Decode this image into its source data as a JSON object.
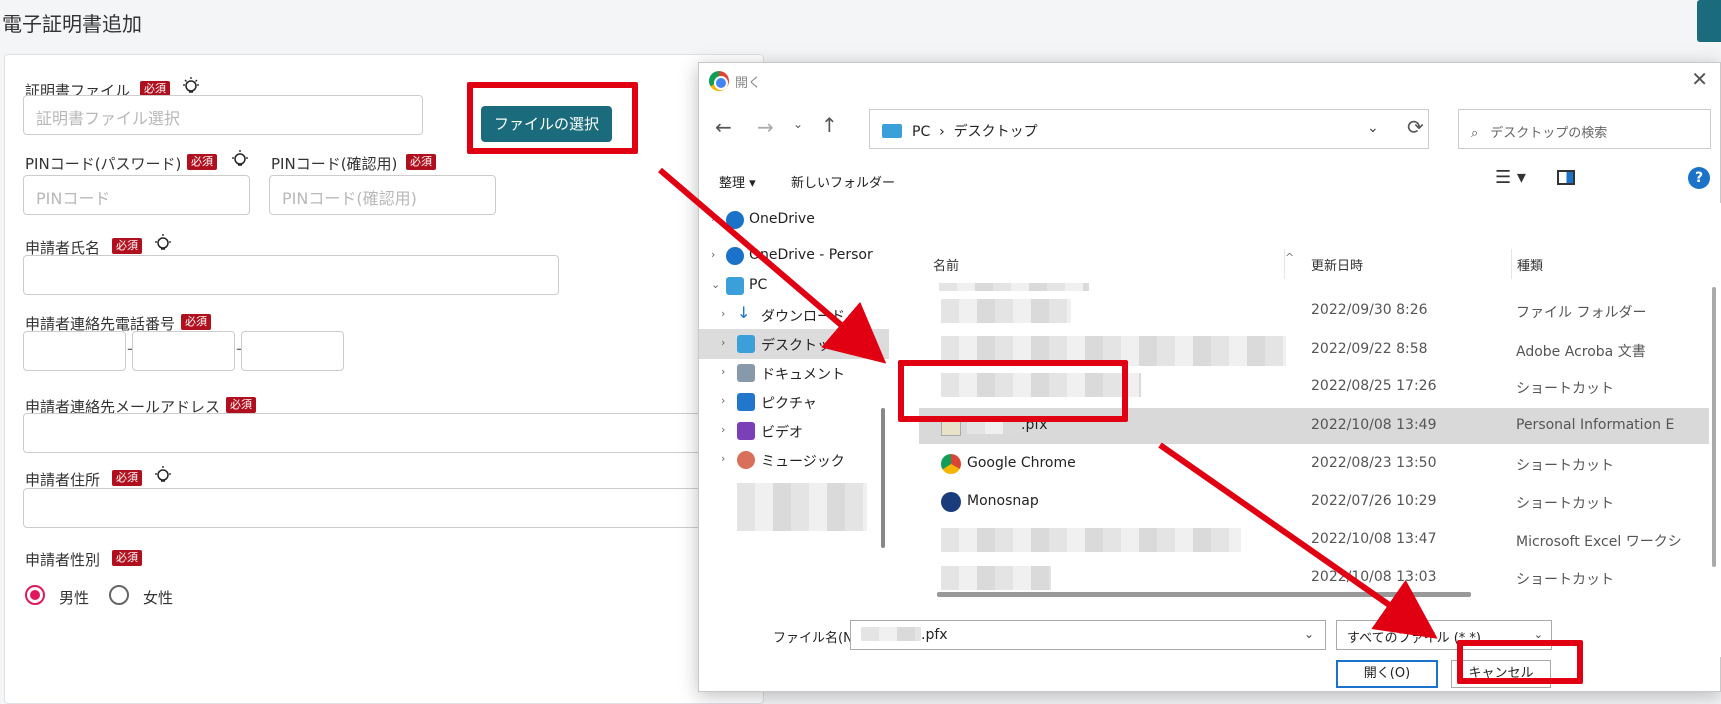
{
  "page": {
    "title": "電子証明書追加"
  },
  "form": {
    "cert_file_label": "証明書ファイル",
    "cert_file_placeholder": "証明書ファイル選択",
    "file_select_button": "ファイルの選択",
    "pin_label": "PINコード(パスワード)",
    "pin_placeholder": "PINコード",
    "pin_confirm_label": "PINコード(確認用)",
    "pin_confirm_placeholder": "PINコード(確認用)",
    "applicant_name_label": "申請者氏名",
    "phone_label": "申請者連絡先電話番号",
    "phone_separator": "-",
    "email_label": "申請者連絡先メールアドレス",
    "address_label": "申請者住所",
    "gender_label": "申請者性別",
    "gender_options": [
      "男性",
      "女性"
    ],
    "gender_selected": "男性",
    "required_badge": "必須"
  },
  "dialog": {
    "title": "開く",
    "breadcrumb": [
      "PC",
      "デスクトップ"
    ],
    "search_placeholder": "デスクトップの検索",
    "toolbar": {
      "organize": "整理 ▾",
      "new_folder": "新しいフォルダー"
    },
    "nav": [
      {
        "label": "OneDrive",
        "icon": "cloud-icon"
      },
      {
        "label": "OneDrive - Persor",
        "icon": "cloud-icon"
      },
      {
        "label": "PC",
        "icon": "computer-icon"
      },
      {
        "label": "ダウンロード",
        "icon": "download-icon"
      },
      {
        "label": "デスクトップ",
        "icon": "desktop-icon"
      },
      {
        "label": "ドキュメント",
        "icon": "document-icon"
      },
      {
        "label": "ピクチャ",
        "icon": "picture-icon"
      },
      {
        "label": "ビデオ",
        "icon": "video-icon"
      },
      {
        "label": "ミュージック",
        "icon": "music-icon"
      }
    ],
    "columns": {
      "name": "名前",
      "date": "更新日時",
      "type": "種類"
    },
    "rows": [
      {
        "name": "",
        "date": "2022/09/30 8:26",
        "type": "ファイル フォルダー"
      },
      {
        "name": "",
        "date": "2022/09/22 8:58",
        "type": "Adobe Acroba 文書"
      },
      {
        "name": "",
        "date": "2022/08/25 17:26",
        "type": "ショートカット"
      },
      {
        "name": ".pfx",
        "date": "2022/10/08 13:49",
        "type": "Personal Information E"
      },
      {
        "name": "Google Chrome",
        "date": "2022/08/23 13:50",
        "type": "ショートカット"
      },
      {
        "name": "Monosnap",
        "date": "2022/07/26 10:29",
        "type": "ショートカット"
      },
      {
        "name": "",
        "date": "2022/10/08 13:47",
        "type": "Microsoft Excel ワークシ"
      },
      {
        "name": "",
        "date": "2022/10/08 13:03",
        "type": "ショートカット"
      }
    ],
    "filename_label": "ファイル名(N):",
    "filename_value": ".pfx",
    "filetype_value": "すべてのファイル (*.*)",
    "open_button": "開く(O)",
    "cancel_button": "キャンセル"
  },
  "colors": {
    "accent": "#1a6b7c",
    "required": "#b0101e",
    "highlight": "#e00012",
    "radio": "#e0195c"
  }
}
